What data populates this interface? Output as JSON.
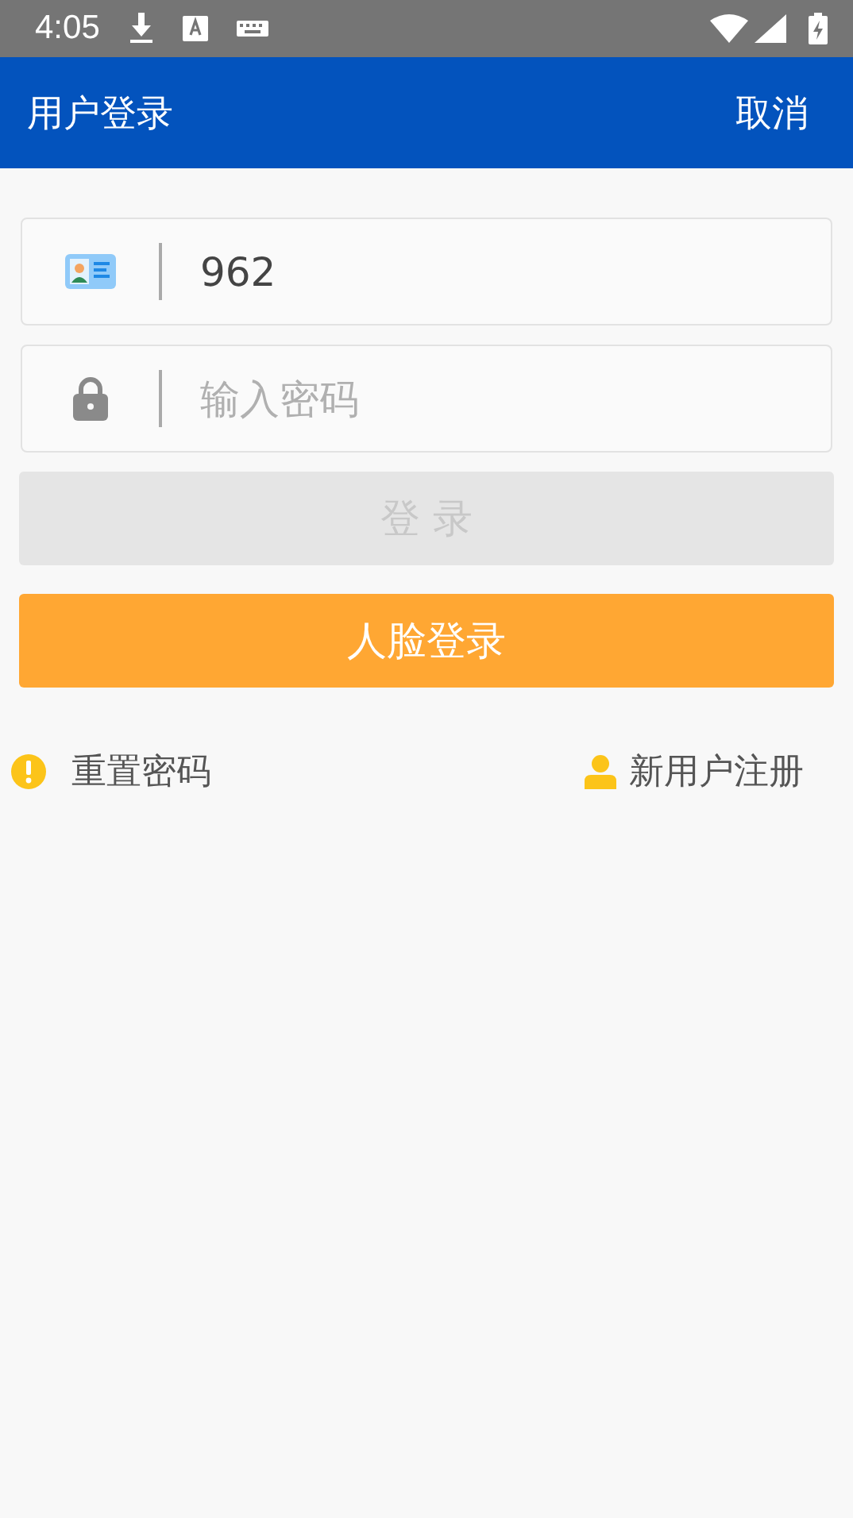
{
  "status_bar": {
    "time": "4:05"
  },
  "app_bar": {
    "title": "用户登录",
    "action": "取消"
  },
  "fields": [
    {
      "kind": "account",
      "value": "962"
    },
    {
      "kind": "password",
      "placeholder": "输入密码"
    }
  ],
  "buttons": [
    {
      "kind": "login",
      "label": "登 录",
      "disabled": true
    },
    {
      "kind": "face",
      "label": "人脸登录",
      "disabled": false
    }
  ],
  "links": [
    {
      "kind": "reset",
      "label": "重置密码"
    },
    {
      "kind": "register",
      "label": "新用户注册"
    }
  ]
}
